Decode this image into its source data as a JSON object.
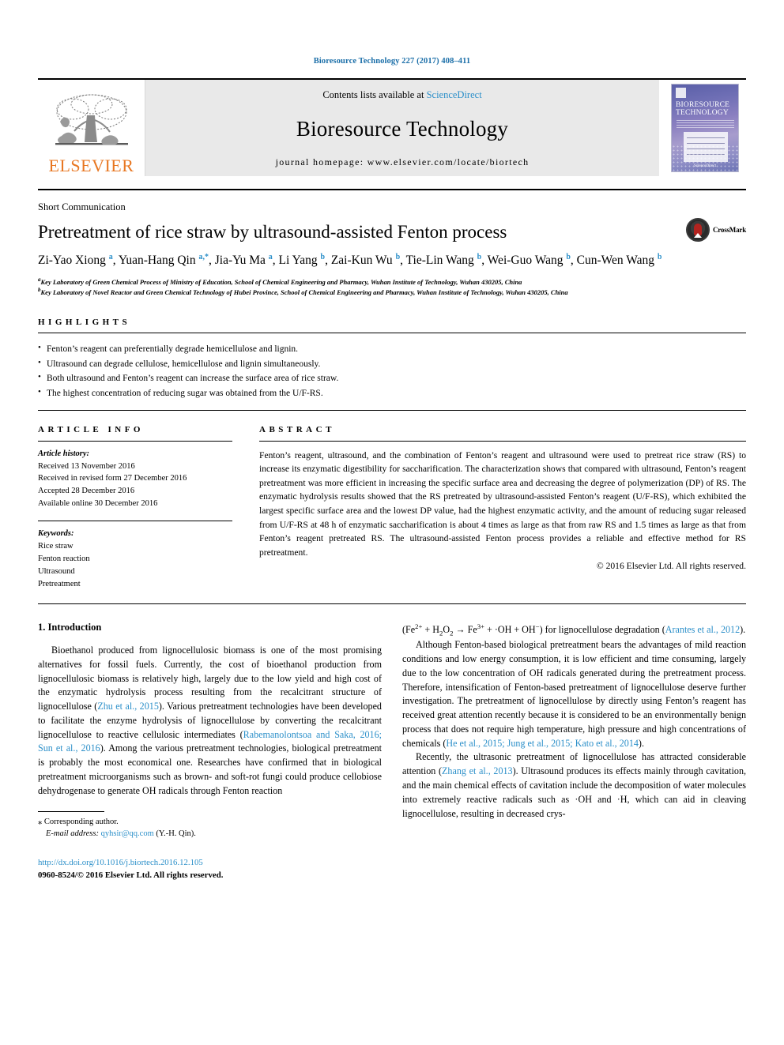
{
  "running_head": "Bioresource Technology 227 (2017) 408–411",
  "masthead": {
    "publisher_name": "ELSEVIER",
    "contents_prefix": "Contents lists available at ",
    "sciencedirect": "ScienceDirect",
    "journal_name": "Bioresource Technology",
    "homepage": "journal homepage: www.elsevier.com/locate/biortech",
    "cover": {
      "line1": "BIORESOURCE",
      "line2": "TECHNOLOGY",
      "footer": "ScienceDirect"
    }
  },
  "article": {
    "doctype": "Short Communication",
    "title": "Pretreatment of rice straw by ultrasound-assisted Fenton process",
    "crossmark_label": "CrossMark",
    "authors_html": "Zi-Yao Xiong <sup>a</sup>, Yuan-Hang Qin <sup>a,*</sup>, Jia-Yu Ma <sup>a</sup>, Li Yang <sup>b</sup>, Zai-Kun Wu <sup>b</sup>, Tie-Lin Wang <sup>b</sup>, Wei-Guo Wang <sup>b</sup>, Cun-Wen Wang <sup>b</sup>",
    "affiliations": [
      "Key Laboratory of Green Chemical Process of Ministry of Education, School of Chemical Engineering and Pharmacy, Wuhan Institute of Technology, Wuhan 430205, China",
      "Key Laboratory of Novel Reactor and Green Chemical Technology of Hubei Province, School of Chemical Engineering and Pharmacy, Wuhan Institute of Technology, Wuhan 430205, China"
    ],
    "affiliation_marks": [
      "a",
      "b"
    ]
  },
  "highlights": {
    "label": "HIGHLIGHTS",
    "items": [
      "Fenton’s reagent can preferentially degrade hemicellulose and lignin.",
      "Ultrasound can degrade cellulose, hemicellulose and lignin simultaneously.",
      "Both ultrasound and Fenton’s reagent can increase the surface area of rice straw.",
      "The highest concentration of reducing sugar was obtained from the U/F-RS."
    ]
  },
  "article_info": {
    "label": "ARTICLE INFO",
    "history_label": "Article history:",
    "history": [
      "Received 13 November 2016",
      "Received in revised form 27 December 2016",
      "Accepted 28 December 2016",
      "Available online 30 December 2016"
    ],
    "keywords_label": "Keywords:",
    "keywords": [
      "Rice straw",
      "Fenton reaction",
      "Ultrasound",
      "Pretreatment"
    ]
  },
  "abstract": {
    "label": "ABSTRACT",
    "text": "Fenton’s reagent, ultrasound, and the combination of Fenton’s reagent and ultrasound were used to pretreat rice straw (RS) to increase its enzymatic digestibility for saccharification. The characterization shows that compared with ultrasound, Fenton’s reagent pretreatment was more efficient in increasing the specific surface area and decreasing the degree of polymerization (DP) of RS. The enzymatic hydrolysis results showed that the RS pretreated by ultrasound-assisted Fenton’s reagent (U/F-RS), which exhibited the largest specific surface area and the lowest DP value, had the highest enzymatic activity, and the amount of reducing sugar released from U/F-RS at 48 h of enzymatic saccharification is about 4 times as large as that from raw RS and 1.5 times as large as that from Fenton’s reagent pretreated RS. The ultrasound-assisted Fenton process provides a reliable and effective method for RS pretreatment.",
    "copyright": "© 2016 Elsevier Ltd. All rights reserved."
  },
  "introduction": {
    "heading": "1. Introduction",
    "left_paragraph_1_parts": {
      "t1": "Bioethanol produced from lignocellulosic biomass is one of the most promising alternatives for fossil fuels. Currently, the cost of bioethanol production from lignocellulosic biomass is relatively high, largely due to the low yield and high cost of the enzymatic hydrolysis process resulting from the recalcitrant structure of lignocellulose (",
      "c1": "Zhu et al., 2015",
      "t2": "). Various pretreatment technologies have been developed to facilitate the enzyme hydrolysis of lignocellulose by converting the recalcitrant lignocellulose to reactive cellulosic intermediates (",
      "c2": "Rabemanolontsoa and Saka, 2016; Sun et al., 2016",
      "t3": "). Among the various pretreatment technologies, biological pretreatment is probably the most economical one. Researches have confirmed that in biological pretreatment microorganisms such as brown- and soft-rot fungi could produce cellobiose dehydrogenase to generate OH radicals through Fenton reaction"
    },
    "right_equation": {
      "prefix": "(Fe",
      "sup1": "2+",
      "mid1": " + H",
      "sub1": "2",
      "mid2": "O",
      "sub2": "2",
      "arrow": " → Fe",
      "sup2": "3+",
      "mid3": " + ·OH + OH",
      "sup3": "−",
      "suffix": ") for lignocellulose degradation ("
    },
    "right_paragraph_1_cite": "Arantes et al., 2012",
    "right_paragraph_1_tail": ").",
    "right_paragraph_2_parts": {
      "t1": "Although Fenton-based biological pretreatment bears the advantages of mild reaction conditions and low energy consumption, it is low efficient and time consuming, largely due to the low concentration of OH radicals generated during the pretreatment process. Therefore, intensification of Fenton-based pretreatment of lignocellulose deserve further investigation. The pretreatment of lignocellulose by directly using Fenton’s reagent has received great attention recently because it is considered to be an environmentally benign process that does not require high temperature, high pressure and high concentrations of chemicals (",
      "c1": "He et al., 2015; Jung et al., 2015; Kato et al., 2014",
      "t2": ")."
    },
    "right_paragraph_3_parts": {
      "t1": "Recently, the ultrasonic pretreatment of lignocellulose has attracted considerable attention (",
      "c1": "Zhang et al., 2013",
      "t2": "). Ultrasound produces its effects mainly through cavitation, and the main chemical effects of cavitation include the decomposition of water molecules into extremely reactive radicals such as ·OH and ·H, which can aid in cleaving lignocellulose, resulting in decreased crys-"
    }
  },
  "footer": {
    "corresponding_mark": "⁎",
    "corresponding_text": "Corresponding author.",
    "email_label": "E-mail address:",
    "email": "qyhsir@qq.com",
    "email_owner": "(Y.-H. Qin).",
    "doi": "http://dx.doi.org/10.1016/j.biortech.2016.12.105",
    "issn_line_1": "0960-8524/",
    "issn_line_2": "© 2016 Elsevier Ltd. All rights reserved."
  },
  "colors": {
    "link_blue": "#2b8fc9",
    "header_blue": "#1a6ea8",
    "elsevier_orange": "#e87722"
  }
}
